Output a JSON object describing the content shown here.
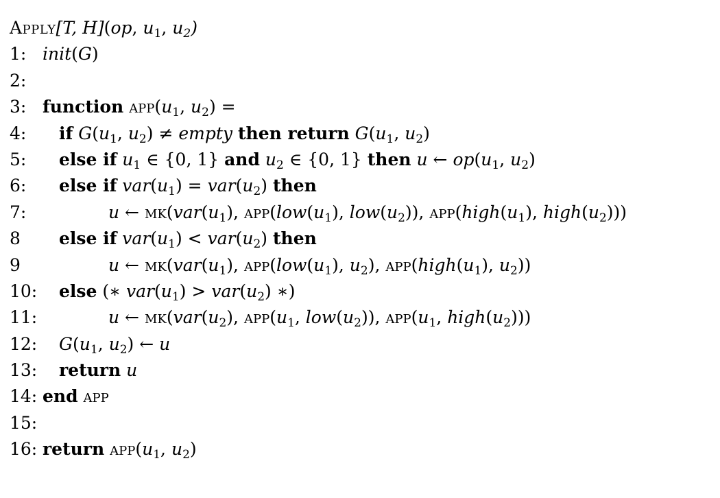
{
  "algorithm": {
    "header": {
      "name": "Apply",
      "params": "[T, H]",
      "args": "(op, u1, u2)"
    },
    "lines": [
      {
        "num": "1:",
        "text": "init(G)"
      },
      {
        "num": "2:",
        "text": ""
      },
      {
        "num": "3:",
        "text": "function APP(u1, u2) ="
      },
      {
        "num": "4:",
        "text": "if G(u1, u2) ≠ empty then return G(u1, u2)"
      },
      {
        "num": "5:",
        "text": "else if u1 ∈ {0, 1} and u2 ∈ {0, 1} then u ← op(u1, u2)"
      },
      {
        "num": "6:",
        "text": "else if var(u1) = var(u2) then"
      },
      {
        "num": "7:",
        "text": "u ← MK(var(u1), APP(low(u1), low(u2)), APP(high(u1), high(u2)))"
      },
      {
        "num": "8",
        "text": "else if var(u1) < var(u2) then"
      },
      {
        "num": "9",
        "text": "u ← MK(var(u1), APP(low(u1), u2), APP(high(u1), u2))"
      },
      {
        "num": "10:",
        "text": "else (∗ var(u1) > var(u2) ∗)"
      },
      {
        "num": "11:",
        "text": "u ← MK(var(u2), APP(u1, low(u2)), APP(u1, high(u2)))"
      },
      {
        "num": "12:",
        "text": "G(u1, u2) ← u"
      },
      {
        "num": "13:",
        "text": "return u"
      },
      {
        "num": "14:",
        "text": "end APP"
      },
      {
        "num": "15:",
        "text": ""
      },
      {
        "num": "16:",
        "text": "return APP(u1, u2)"
      }
    ]
  }
}
